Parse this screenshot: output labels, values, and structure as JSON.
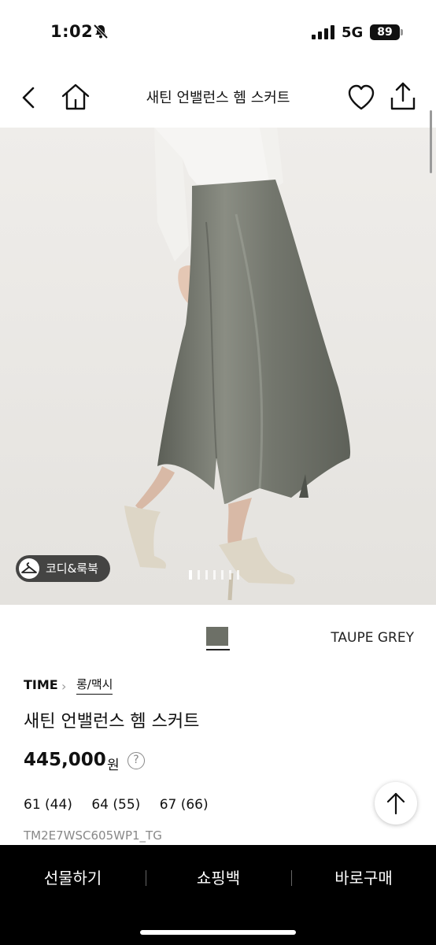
{
  "status": {
    "time": "1:02",
    "network": "5G",
    "battery": "89"
  },
  "header": {
    "title": "새틴 언밸런스 헴 스커트"
  },
  "gallery": {
    "coord_label": "코디&룩북",
    "dot_count": 7,
    "active_index": 0
  },
  "color": {
    "name": "TAUPE GREY",
    "swatch": "#6d7067"
  },
  "product": {
    "brand": "TIME",
    "category": "롱/맥시",
    "name": "새틴 언밸런스 헴 스커트",
    "price": "445,000",
    "currency": "원",
    "help": "?",
    "sizes": [
      "61 (44)",
      "64 (55)",
      "67 (66)"
    ],
    "code": "TM2E7WSC605WP1_TG"
  },
  "bottom_bar": {
    "gift": "선물하기",
    "cart": "쇼핑백",
    "buy": "바로구매"
  },
  "icons": [
    "bell-off-icon",
    "signal-icon",
    "back-icon",
    "home-icon",
    "heart-icon",
    "share-icon",
    "hanger-icon",
    "arrow-up-icon"
  ],
  "colors": {
    "bottom_bar": "#000000",
    "skirt": "#6d7067",
    "background": "#ebe9e6"
  }
}
